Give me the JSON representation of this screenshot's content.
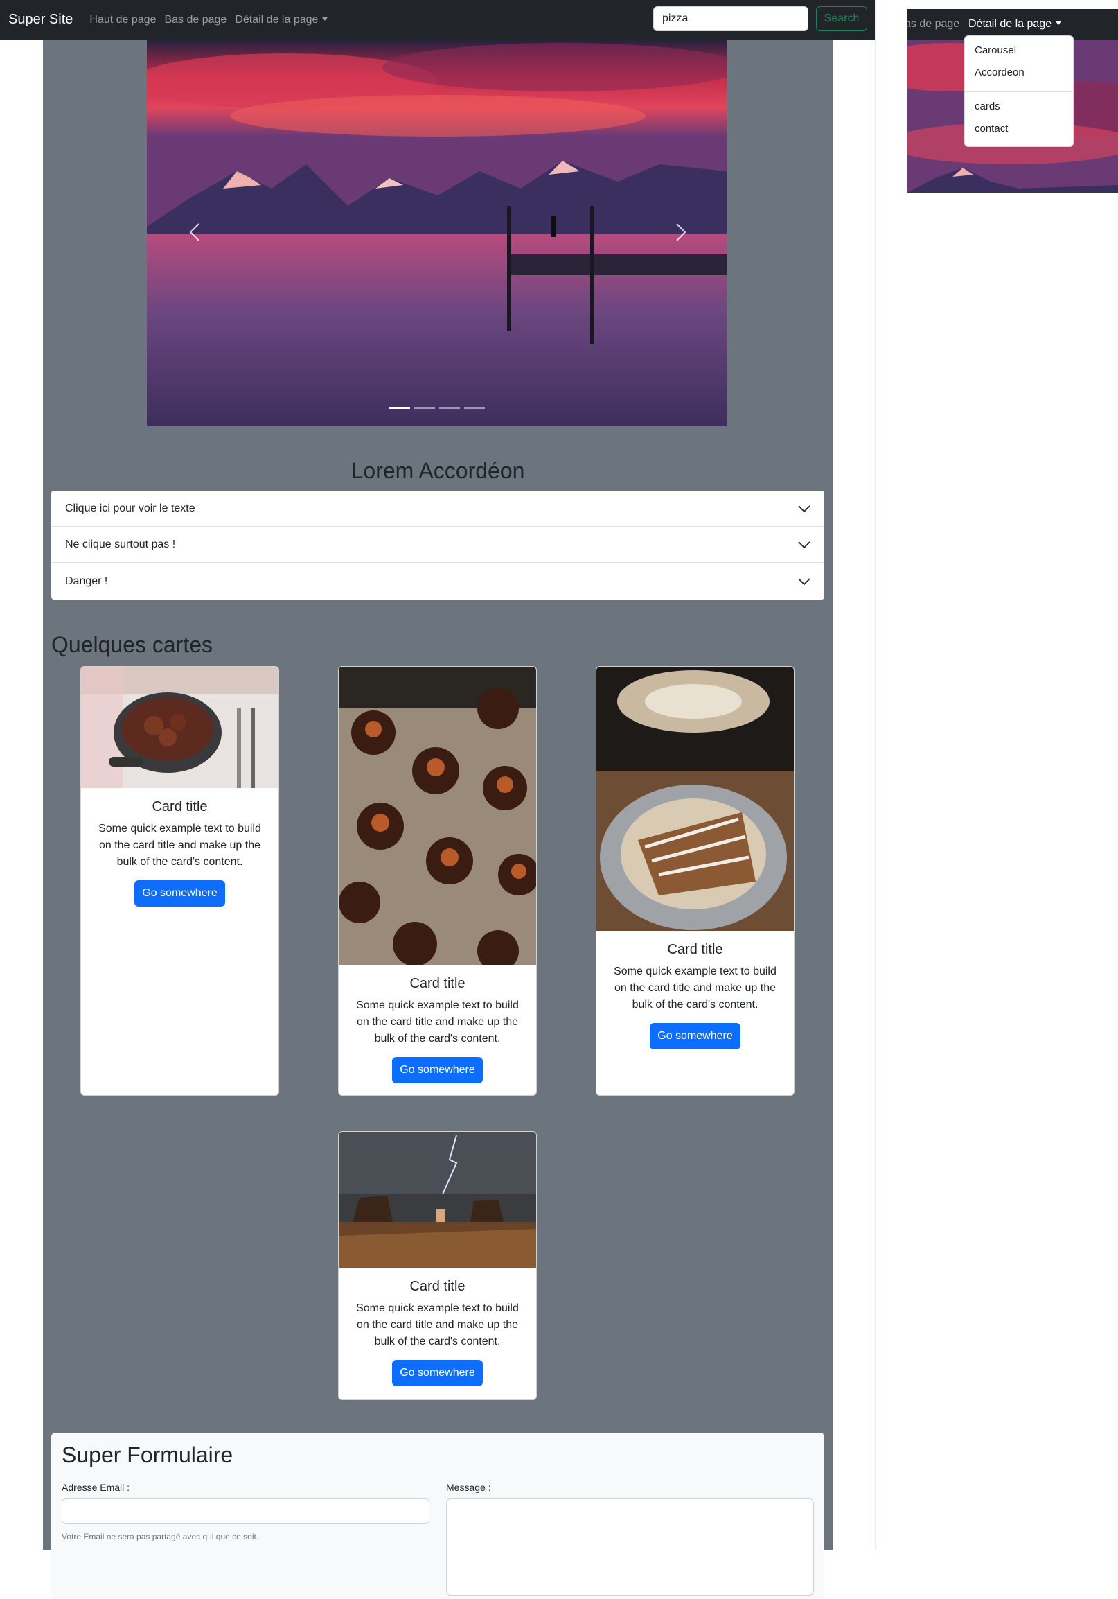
{
  "navbar": {
    "brand": "Super Site",
    "links": [
      "Haut de page",
      "Bas de page",
      "Détail de la page"
    ],
    "search_value": "pizza",
    "search_button": "Search"
  },
  "carousel": {
    "slide_count": 4,
    "active_index": 0
  },
  "accordion": {
    "title": "Lorem Accordéon",
    "items": [
      "Clique ici pour voir le texte",
      "Ne clique surtout pas !",
      "Danger !"
    ]
  },
  "cards_section": {
    "title": "Quelques cartes",
    "cards": [
      {
        "title": "Card title",
        "text": "Some quick example text to build on the card title and make up the bulk of the card's content.",
        "button": "Go somewhere",
        "image": "beef-stew-image"
      },
      {
        "title": "Card title",
        "text": "Some quick example text to build on the card title and make up the bulk of the card's content.",
        "button": "Go somewhere",
        "image": "canneles-image"
      },
      {
        "title": "Card title",
        "text": "Some quick example text to build on the card title and make up the bulk of the card's content.",
        "button": "Go somewhere",
        "image": "okonomiyaki-image"
      },
      {
        "title": "Card title",
        "text": "Some quick example text to build on the card title and make up the bulk of the card's content.",
        "button": "Go somewhere",
        "image": "desert-storm-image"
      }
    ]
  },
  "form": {
    "title": "Super Formulaire",
    "email_label": "Adresse Email :",
    "email_help": "Votre Email ne sera pas partagé avec qui que ce soit.",
    "message_label": "Message :"
  },
  "dropdown_inset": {
    "partial_link": "as de page",
    "active_link": "Détail de la page",
    "menu_items": [
      "Carousel",
      "Accordeon",
      "cards",
      "contact"
    ]
  },
  "colors": {
    "navbar": "#212529",
    "container": "#6c757d",
    "primary": "#0d6efd",
    "success": "#198754"
  }
}
